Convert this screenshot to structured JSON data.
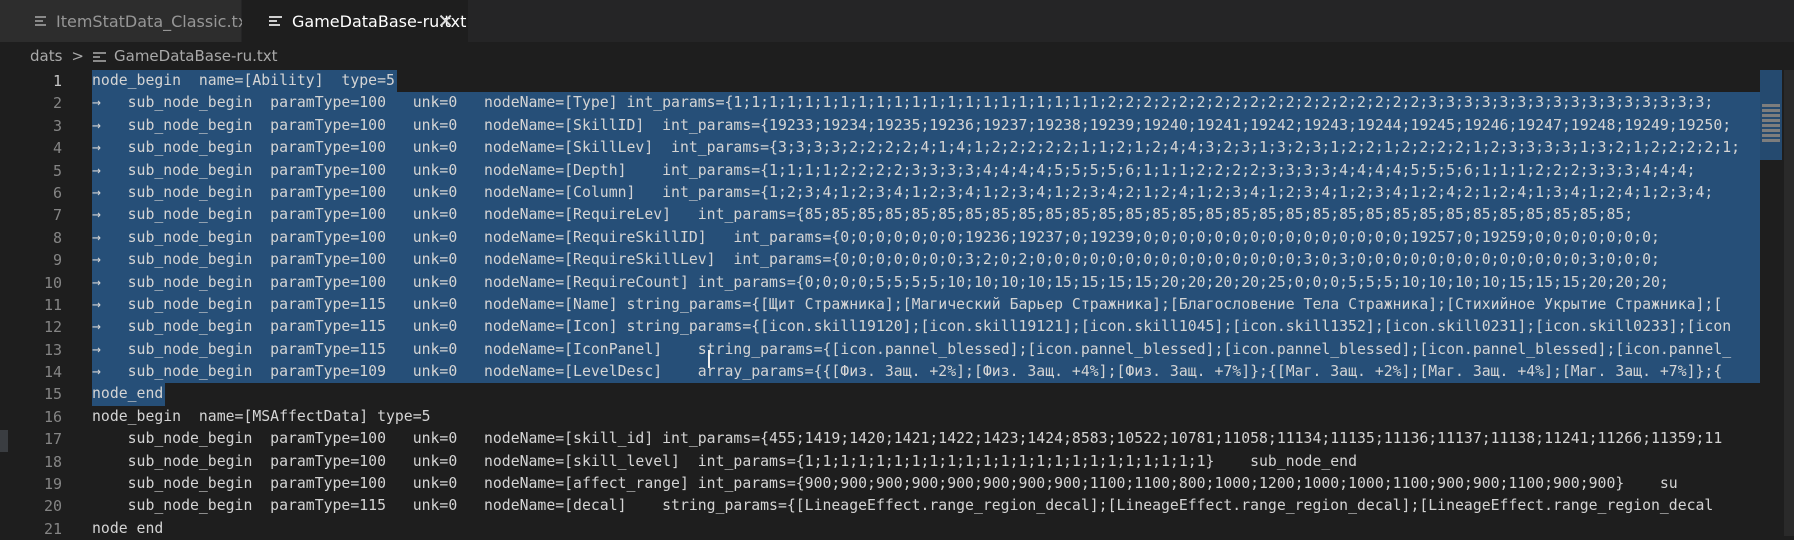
{
  "tabs": [
    {
      "label": "ItemStatData_Classic.txt",
      "active": false
    },
    {
      "label": "GameDataBase-ru.txt",
      "active": true,
      "close": "✕"
    }
  ],
  "breadcrumb": {
    "folder": "dats",
    "separator": ">",
    "file": "GameDataBase-ru.txt"
  },
  "line_numbers": [
    "1",
    "2",
    "3",
    "4",
    "5",
    "6",
    "7",
    "8",
    "9",
    "10",
    "11",
    "12",
    "13",
    "14",
    "15",
    "16",
    "17",
    "18",
    "19",
    "20",
    "21"
  ],
  "lines": [
    "node_begin  name=[Ability]  type=5",
    "→   sub_node_begin  paramType=100   unk=0   nodeName=[Type] int_params={1;1;1;1;1;1;1;1;1;1;1;1;1;1;1;1;1;1;1;1;1;2;2;2;2;2;2;2;2;2;2;2;2;2;2;2;2;2;2;3;3;3;3;3;3;3;3;3;3;3;3;3;3;3;3;",
    "→   sub_node_begin  paramType=100   unk=0   nodeName=[SkillID]  int_params={19233;19234;19235;19236;19237;19238;19239;19240;19241;19242;19243;19244;19245;19246;19247;19248;19249;19250;",
    "→   sub_node_begin  paramType=100   unk=0   nodeName=[SkillLev]  int_params={3;3;3;3;2;2;2;2;4;1;4;1;2;2;2;2;2;1;1;2;1;2;4;4;3;2;3;1;3;2;3;1;2;2;1;2;2;2;2;1;2;3;3;3;3;1;3;2;1;2;2;2;2;1;",
    "→   sub_node_begin  paramType=100   unk=0   nodeName=[Depth]    int_params={1;1;1;1;2;2;2;2;3;3;3;3;4;4;4;4;5;5;5;5;6;1;1;1;2;2;2;2;3;3;3;3;4;4;4;4;5;5;5;6;1;1;1;2;2;2;3;3;3;4;4;4;",
    "→   sub_node_begin  paramType=100   unk=0   nodeName=[Column]   int_params={1;2;3;4;1;2;3;4;1;2;3;4;1;2;3;4;1;2;3;4;2;1;2;4;1;2;3;4;1;2;3;4;1;2;3;4;1;2;4;2;1;2;4;1;3;4;1;2;4;1;2;3;4;",
    "→   sub_node_begin  paramType=100   unk=0   nodeName=[RequireLev]   int_params={85;85;85;85;85;85;85;85;85;85;85;85;85;85;85;85;85;85;85;85;85;85;85;85;85;85;85;85;85;85;85;",
    "→   sub_node_begin  paramType=100   unk=0   nodeName=[RequireSkillID]   int_params={0;0;0;0;0;0;0;19236;19237;0;19239;0;0;0;0;0;0;0;0;0;0;0;0;0;0;0;19257;0;19259;0;0;0;0;0;0;0;",
    "→   sub_node_begin  paramType=100   unk=0   nodeName=[RequireSkillLev]  int_params={0;0;0;0;0;0;0;3;2;0;2;0;0;0;0;0;0;0;0;0;0;0;0;0;0;0;3;0;3;0;0;0;0;0;0;0;0;0;0;0;0;0;3;0;0;0;",
    "→   sub_node_begin  paramType=100   unk=0   nodeName=[RequireCount] int_params={0;0;0;0;5;5;5;5;10;10;10;10;15;15;15;15;20;20;20;20;25;0;0;0;5;5;5;10;10;10;10;15;15;15;20;20;20;",
    "→   sub_node_begin  paramType=115   unk=0   nodeName=[Name] string_params={[Щит Стражника];[Магический Барьер Стражника];[Благословение Тела Стражника];[Стихийное Укрытие Стражника];[",
    "→   sub_node_begin  paramType=115   unk=0   nodeName=[Icon] string_params={[icon.skill19120];[icon.skill19121];[icon.skill1045];[icon.skill1352];[icon.skill0231];[icon.skill0233];[icon",
    "→   sub_node_begin  paramType=115   unk=0   nodeName=[IconPanel]    string_params={[icon.pannel_blessed];[icon.pannel_blessed];[icon.pannel_blessed];[icon.pannel_blessed];[icon.pannel_",
    "→   sub_node_begin  paramType=109   unk=0   nodeName=[LevelDesc]    array_params={{[Физ. Защ. +2%];[Физ. Защ. +4%];[Физ. Защ. +7%]};{[Маг. Защ. +2%];[Маг. Защ. +4%];[Маг. Защ. +7%]};{",
    "node_end",
    "node_begin  name=[MSAffectData] type=5",
    "    sub_node_begin  paramType=100   unk=0   nodeName=[skill_id] int_params={455;1419;1420;1421;1422;1423;1424;8583;10522;10781;11058;11134;11135;11136;11137;11138;11241;11266;11359;11",
    "    sub_node_begin  paramType=100   unk=0   nodeName=[skill_level]  int_params={1;1;1;1;1;1;1;1;1;1;1;1;1;1;1;1;1;1;1;1;1;1;1}    sub_node_end",
    "    sub_node_begin  paramType=100   unk=0   nodeName=[affect_range] int_params={900;900;900;900;900;900;900;900;1100;1100;800;1000;1200;1000;1000;1100;900;900;1100;900;900}    su",
    "    sub_node_begin  paramType=115   unk=0   nodeName=[decal]    string_params={[LineageEffect.range_region_decal];[LineageEffect.range_region_decal];[LineageEffect.range_region_decal",
    "node_end"
  ],
  "selection": {
    "from_line": 1,
    "to_line": 15
  },
  "colors": {
    "selection": "#264f78",
    "background": "#1e1e1e",
    "tabbar": "#252526"
  }
}
